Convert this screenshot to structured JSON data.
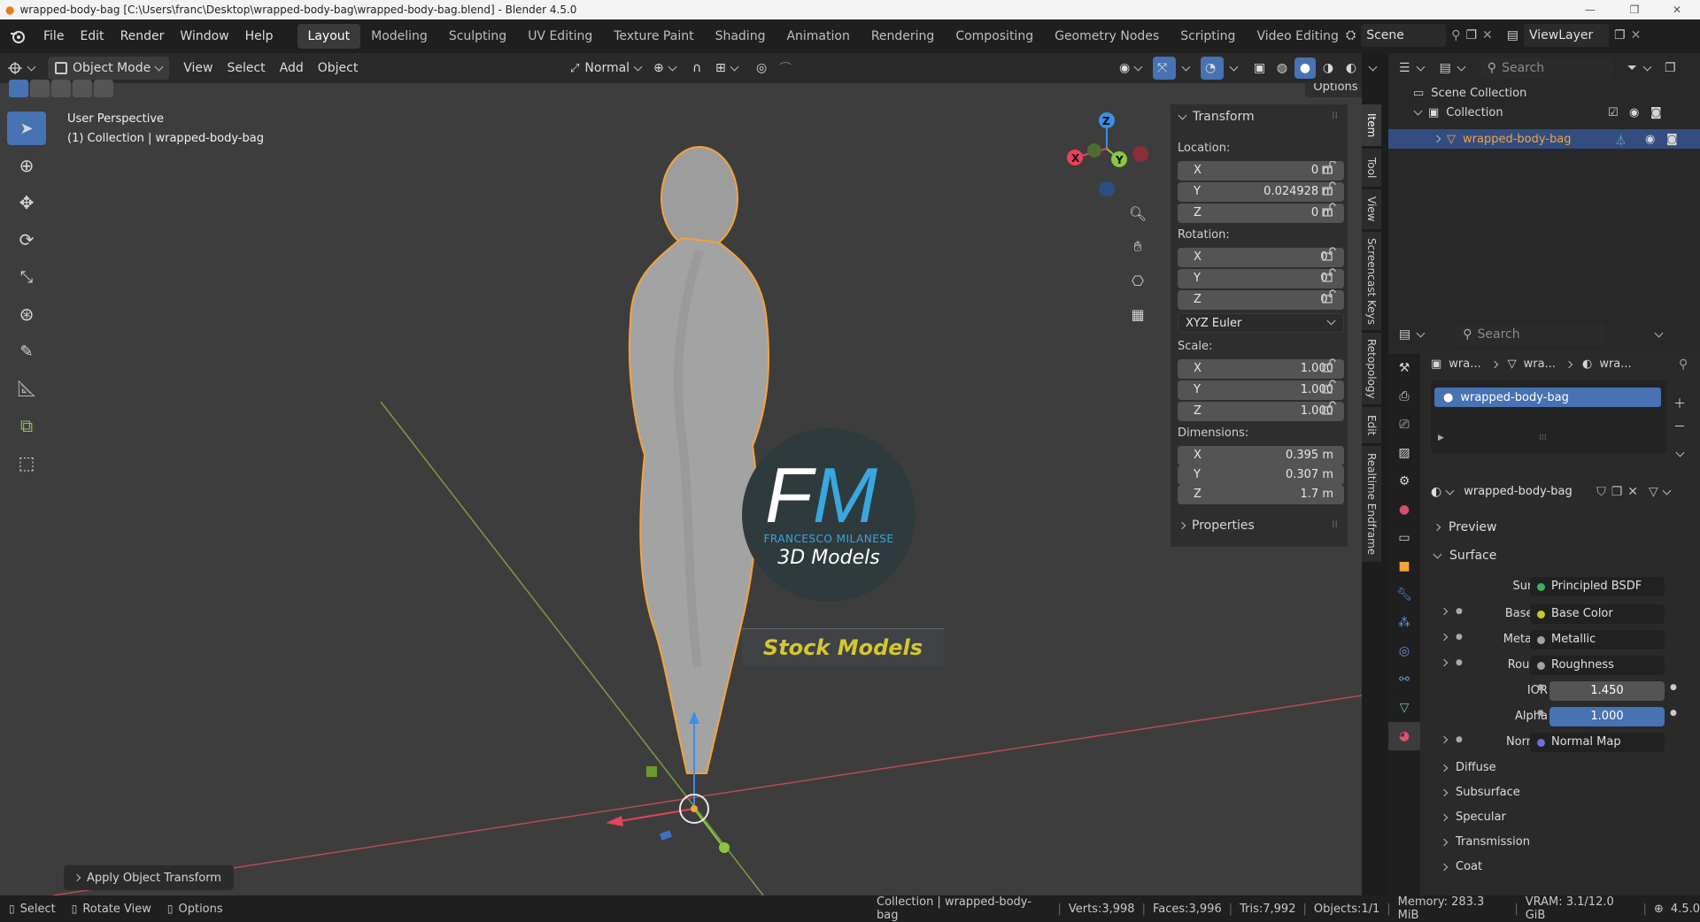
{
  "window": {
    "title": "wrapped-body-bag [C:\\Users\\franc\\Desktop\\wrapped-body-bag\\wrapped-body-bag.blend] - Blender 4.5.0"
  },
  "menus": [
    "File",
    "Edit",
    "Render",
    "Window",
    "Help"
  ],
  "workspaces": [
    "Layout",
    "Modeling",
    "Sculpting",
    "UV Editing",
    "Texture Paint",
    "Shading",
    "Animation",
    "Rendering",
    "Compositing",
    "Geometry Nodes",
    "Scripting",
    "Video Editing"
  ],
  "active_workspace": "Layout",
  "scene": {
    "name": "Scene",
    "view_layer": "ViewLayer"
  },
  "viewport_header": {
    "mode": "Object Mode",
    "menus": [
      "View",
      "Select",
      "Add",
      "Object"
    ],
    "orientation": "Normal",
    "options": "Options"
  },
  "viewport": {
    "perspective": "User Perspective",
    "collection_info": "(1) Collection | wrapped-body-bag",
    "last_operator": "Apply Object Transform",
    "gizmo_axes": [
      "X",
      "Y",
      "Z"
    ]
  },
  "watermark": {
    "letters": "FM",
    "name": "FRANCESCO MILANESE",
    "line": "3D Models",
    "banner": "Stock Models"
  },
  "npanel": {
    "header": "Transform",
    "location_label": "Location:",
    "location": [
      {
        "axis": "X",
        "value": "0 m"
      },
      {
        "axis": "Y",
        "value": "0.024928 m"
      },
      {
        "axis": "Z",
        "value": "0 m"
      }
    ],
    "rotation_label": "Rotation:",
    "rotation": [
      {
        "axis": "X",
        "value": "0°"
      },
      {
        "axis": "Y",
        "value": "0°"
      },
      {
        "axis": "Z",
        "value": "0°"
      }
    ],
    "rotation_mode": "XYZ Euler",
    "scale_label": "Scale:",
    "scale": [
      {
        "axis": "X",
        "value": "1.000"
      },
      {
        "axis": "Y",
        "value": "1.000"
      },
      {
        "axis": "Z",
        "value": "1.000"
      }
    ],
    "dimensions_label": "Dimensions:",
    "dimensions": [
      {
        "axis": "X",
        "value": "0.395 m"
      },
      {
        "axis": "Y",
        "value": "0.307 m"
      },
      {
        "axis": "Z",
        "value": "1.7 m"
      }
    ],
    "properties": "Properties",
    "tabs": [
      "Item",
      "Tool",
      "View",
      "Screencast Keys",
      "Retopology",
      "Edit",
      "Realtime Endframe"
    ]
  },
  "outliner": {
    "search_placeholder": "Search",
    "root": "Scene Collection",
    "collection": "Collection",
    "object": "wrapped-body-bag"
  },
  "properties": {
    "search_placeholder": "Search",
    "breadcrumb": [
      "wra...",
      "wra...",
      "wra..."
    ],
    "material_slot": "wrapped-body-bag",
    "material_name": "wrapped-body-bag",
    "sections": {
      "preview": "Preview",
      "surface": "Surface"
    },
    "surface_label": "Surface",
    "surface_value": "Principled BSDF",
    "inputs": [
      {
        "label": "Base ...",
        "value": "Base Color",
        "dot": "#c7c729"
      },
      {
        "label": "Metallic",
        "value": "Metallic",
        "dot": "#a1a1a1"
      },
      {
        "label": "Roug...",
        "value": "Roughness",
        "dot": "#a1a1a1"
      }
    ],
    "ior_label": "IOR",
    "ior": "1.450",
    "alpha_label": "Alpha",
    "alpha": "1.000",
    "normal_label": "Normal",
    "normal_value": "Normal Map",
    "subsections": [
      "Diffuse",
      "Subsurface",
      "Specular",
      "Transmission",
      "Coat"
    ]
  },
  "statusbar": {
    "hints": [
      "Select",
      "Rotate View",
      "Options"
    ],
    "collection": "Collection | wrapped-body-bag",
    "verts": "Verts:3,998",
    "faces": "Faces:3,996",
    "tris": "Tris:7,992",
    "objects": "Objects:1/1",
    "memory": "Memory: 283.3 MiB",
    "vram": "VRAM: 3.1/12.0 GiB",
    "version": "4.5.0"
  },
  "colors": {
    "accent": "#4772b3",
    "selection_outline": "#f5a23c",
    "x_axis": "#e8425a",
    "y_axis": "#8bc541",
    "z_axis": "#3d8ee6"
  }
}
